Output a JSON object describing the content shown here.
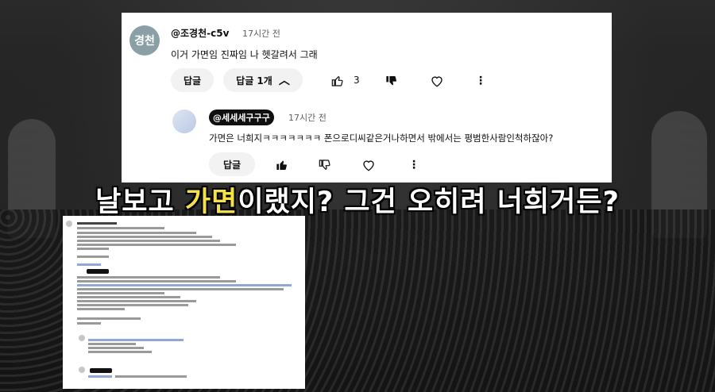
{
  "top_comment": {
    "avatar_text": "경천",
    "handle": "@조경천-c5v",
    "time": "17시간 전",
    "text": "이거 가면임 진짜임 나 헷갈려서 그래",
    "reply_button": "답글",
    "replies_toggle": "답글 1개",
    "like_count": "3"
  },
  "reply_comment": {
    "handle": "@세세세구구구",
    "time": "17시간 전",
    "text": "가면은 너희지ㅋㅋㅋㅋㅋㅋㅋ 폰으로디씨같은거나하면서 밖에서는 평범한사람인척하잖아?",
    "reply_button": "답글"
  },
  "caption": {
    "part1": "날보고 ",
    "highlight": "가면",
    "part2": "이랬지? 그건 오히려 너희거든?"
  },
  "colors": {
    "caption_highlight": "#f5e04a",
    "background": "#1b1b1b"
  },
  "icons": {
    "thumbs_up": "thumbs-up-icon",
    "thumbs_down": "thumbs-down-icon",
    "heart": "heart-icon",
    "more": "more-vert-icon",
    "chevron": "chevron-up-icon"
  }
}
